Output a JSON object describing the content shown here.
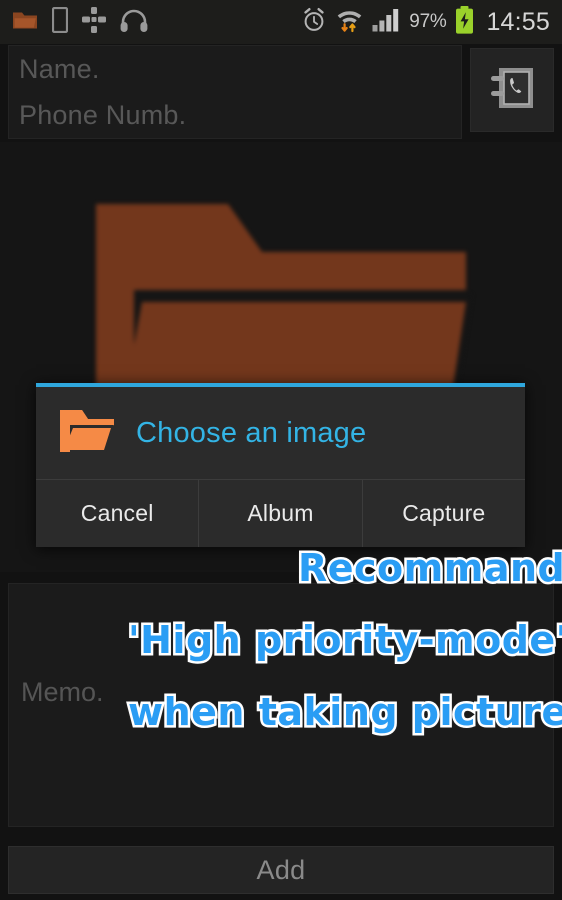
{
  "statusbar": {
    "left_icons": [
      {
        "name": "folder-icon",
        "glyph": "folder"
      },
      {
        "name": "sim-card-icon",
        "glyph": "sim"
      },
      {
        "name": "sync-dots-icon",
        "glyph": "dots"
      },
      {
        "name": "headphones-icon",
        "glyph": "headphones"
      }
    ],
    "right_icons": [
      {
        "name": "alarm-clock-icon",
        "glyph": "alarm"
      },
      {
        "name": "wifi-transfer-icon",
        "glyph": "wifi"
      },
      {
        "name": "signal-bars-icon",
        "glyph": "signal"
      }
    ],
    "battery_percent": "97%",
    "battery_state": "charging",
    "clock": "14:55"
  },
  "form": {
    "name_placeholder": "Name.",
    "name_value": "",
    "phone_placeholder": "Phone Numb.",
    "phone_value": "",
    "contacts_button_icon": "contacts-book-icon"
  },
  "preview": {
    "image_name": "folder-placeholder-image",
    "folder_color": "#7b3a1d"
  },
  "dialog": {
    "title": "Choose an image",
    "title_color": "#33b4e5",
    "accent_color": "#2fa7dd",
    "icon_name": "orange-folder-icon",
    "icon_color": "#f58a46",
    "buttons": [
      {
        "name": "cancel-button",
        "label": "Cancel"
      },
      {
        "name": "album-button",
        "label": "Album"
      },
      {
        "name": "capture-button",
        "label": "Capture"
      }
    ]
  },
  "memo": {
    "placeholder": "Memo.",
    "value": ""
  },
  "footer": {
    "add_label": "Add"
  },
  "annotation": {
    "text_color": "#2a9df4",
    "outline_color": "#ffffff",
    "lines": [
      "Recommand",
      "'High priority-mode'",
      "when taking pictures"
    ]
  }
}
